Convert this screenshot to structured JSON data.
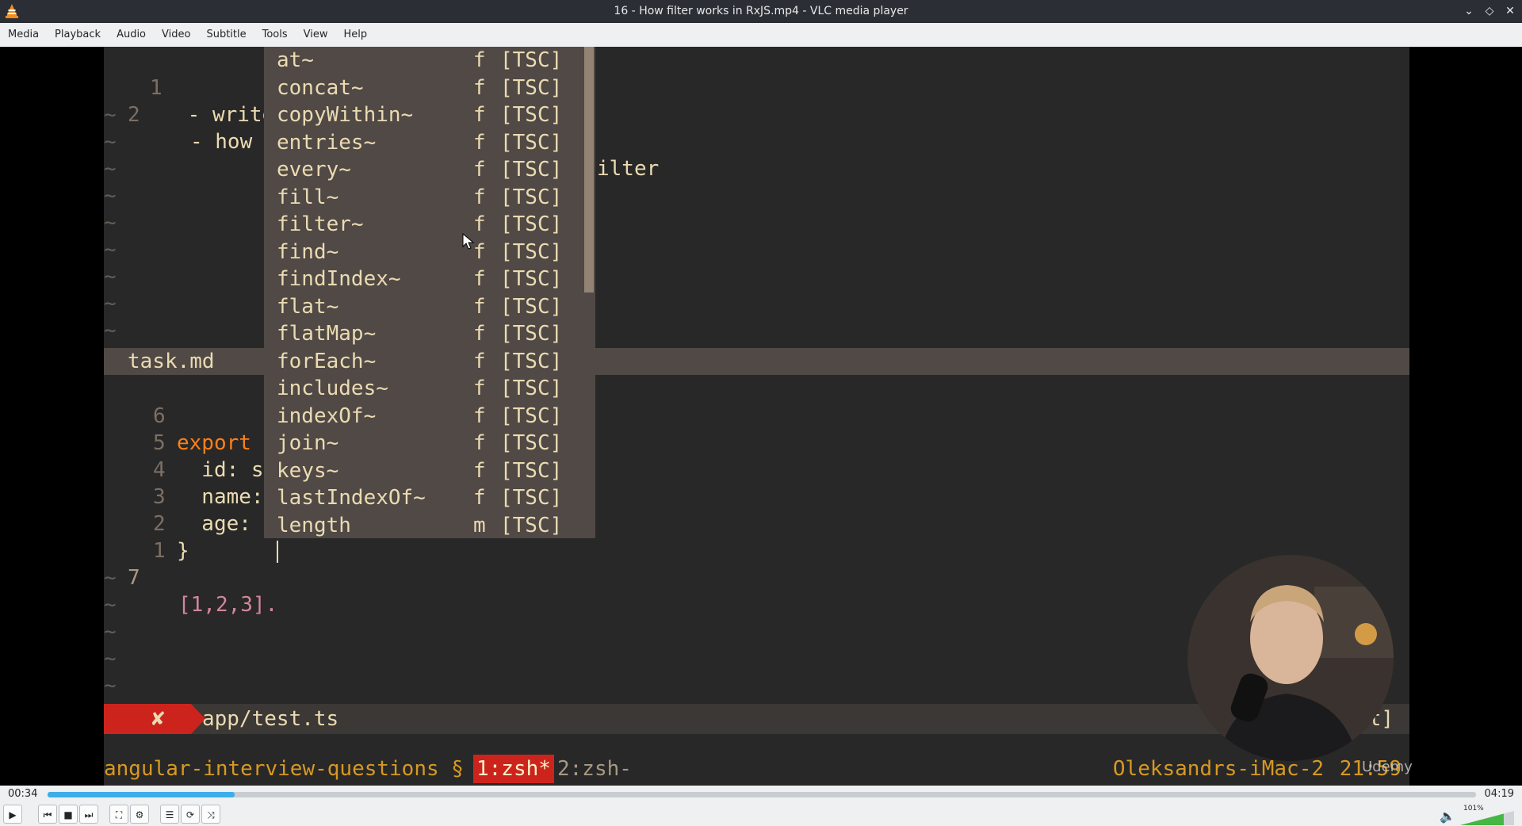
{
  "window": {
    "title": "16 - How filter works in RxJS.mp4 - VLC media player",
    "controls": [
      "⌄",
      "◇",
      "✕"
    ]
  },
  "menu": [
    "Media",
    "Playback",
    "Audio",
    "Video",
    "Subtitle",
    "Tools",
    "View",
    "Help"
  ],
  "editor": {
    "top_lines": [
      {
        "num": "1",
        "text": " - write"
      },
      {
        "num": "2",
        "text": "   - how i"
      }
    ],
    "top_line2_tail": "ilter",
    "split_file": "task.md",
    "bottom_lines": [
      {
        "num": "6",
        "kw": "export",
        "text": ""
      },
      {
        "num": "5",
        "kw": "",
        "text": "  id: s"
      },
      {
        "num": "4",
        "kw": "",
        "text": "  name:"
      },
      {
        "num": "3",
        "kw": "",
        "text": "  age:"
      },
      {
        "num": "2",
        "kw": "",
        "text": "}"
      },
      {
        "num": "1",
        "kw": "",
        "text": ""
      }
    ],
    "current_line": {
      "num": "7",
      "text": "[1,2,3]."
    },
    "tilde": "~"
  },
  "completion": [
    {
      "word": "at~",
      "kind": "f",
      "source": "[TSC]"
    },
    {
      "word": "concat~",
      "kind": "f",
      "source": "[TSC]"
    },
    {
      "word": "copyWithin~",
      "kind": "f",
      "source": "[TSC]"
    },
    {
      "word": "entries~",
      "kind": "f",
      "source": "[TSC]"
    },
    {
      "word": "every~",
      "kind": "f",
      "source": "[TSC]"
    },
    {
      "word": "fill~",
      "kind": "f",
      "source": "[TSC]"
    },
    {
      "word": "filter~",
      "kind": "f",
      "source": "[TSC]"
    },
    {
      "word": "find~",
      "kind": "f",
      "source": "[TSC]"
    },
    {
      "word": "findIndex~",
      "kind": "f",
      "source": "[TSC]"
    },
    {
      "word": "flat~",
      "kind": "f",
      "source": "[TSC]"
    },
    {
      "word": "flatMap~",
      "kind": "f",
      "source": "[TSC]"
    },
    {
      "word": "forEach~",
      "kind": "f",
      "source": "[TSC]"
    },
    {
      "word": "includes~",
      "kind": "f",
      "source": "[TSC]"
    },
    {
      "word": "indexOf~",
      "kind": "f",
      "source": "[TSC]"
    },
    {
      "word": "join~",
      "kind": "f",
      "source": "[TSC]"
    },
    {
      "word": "keys~",
      "kind": "f",
      "source": "[TSC]"
    },
    {
      "word": "lastIndexOf~",
      "kind": "f",
      "source": "[TSC]"
    },
    {
      "word": "length",
      "kind": "m",
      "source": "[TSC]"
    }
  ],
  "statusline": {
    "error_icon": "✘",
    "file": "app/test.ts",
    "right": "t]"
  },
  "tmux": {
    "session": "angular-interview-questions §",
    "window1": "1:zsh*",
    "window2": "2:zsh-",
    "host": "Oleksandrs-iMac-2",
    "time": "21:59"
  },
  "watermark": "Udemy",
  "player": {
    "elapsed": "00:34",
    "total": "04:19",
    "progress_fraction": 0.131,
    "volume_label": "101%",
    "buttons": {
      "play": "▶",
      "prev": "⏮",
      "stop": "■",
      "next": "⏭",
      "fullscreen": "⛶",
      "extended": "⚙",
      "playlist": "☰",
      "loop": "⟳",
      "shuffle": "⤨"
    }
  }
}
